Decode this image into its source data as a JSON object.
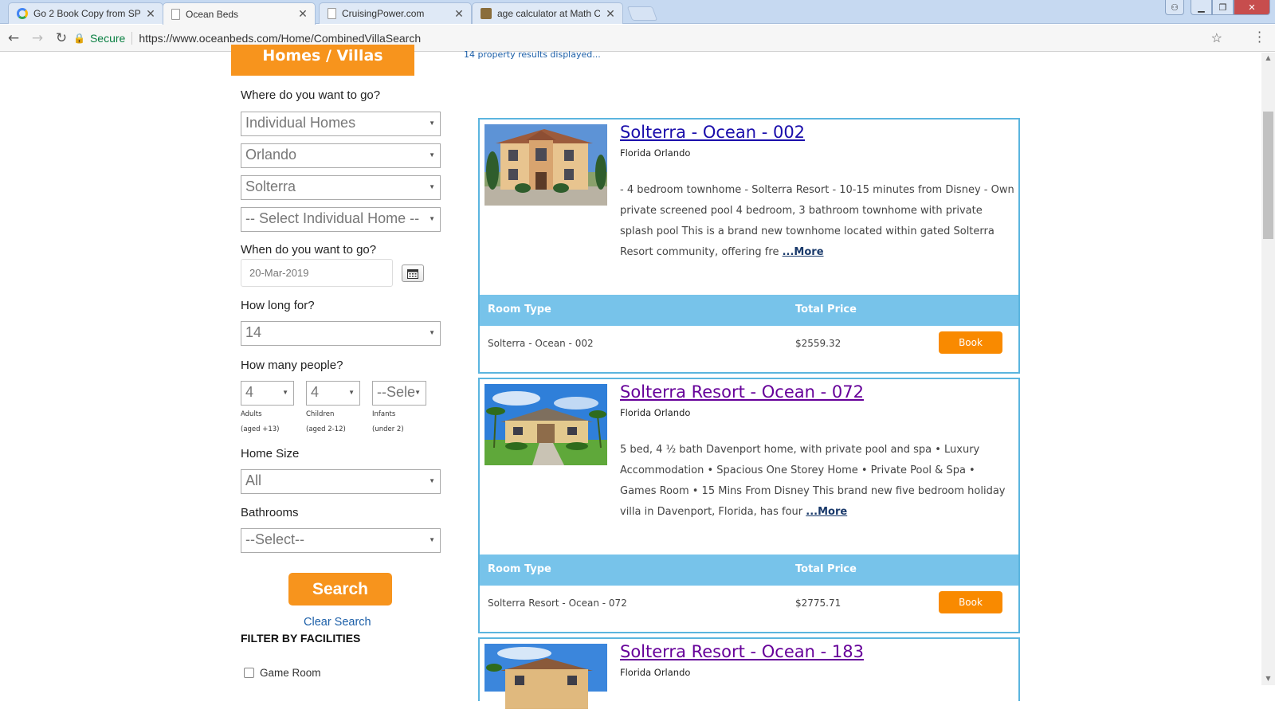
{
  "browser": {
    "tabs": [
      {
        "title": "Go 2 Book Copy from SP",
        "active": false
      },
      {
        "title": "Ocean Beds",
        "active": true
      },
      {
        "title": "CruisingPower.com",
        "active": false
      },
      {
        "title": "age calculator at Math C",
        "active": false
      }
    ],
    "secure_label": "Secure",
    "url": "https://www.oceanbeds.com/Home/CombinedVillaSearch"
  },
  "header": {
    "banner": "Homes / Villas",
    "results_count": "14 property results displayed..."
  },
  "search": {
    "where_label": "Where do you want to go?",
    "property_type": "Individual Homes",
    "city": "Orlando",
    "resort": "Solterra",
    "home": "-- Select Individual Home --",
    "when_label": "When do you want to go?",
    "date": "20-Mar-2019",
    "duration_label": "How long for?",
    "duration": "14",
    "people_label": "How many people?",
    "adults": "4",
    "children": "4",
    "infants": "--Sele",
    "adults_label": "Adults",
    "adults_note": "(aged +13)",
    "children_label": "Children",
    "children_note": "(aged 2-12)",
    "infants_label": "Infants",
    "infants_note": "(under 2)",
    "home_size_label": "Home Size",
    "home_size": "All",
    "bathrooms_label": "Bathrooms",
    "bathrooms": "--Select--",
    "search_button": "Search",
    "clear_search": "Clear Search",
    "filter_heading": "FILTER BY FACILITIES",
    "facilities": [
      "Game Room"
    ]
  },
  "results": [
    {
      "title": "Solterra - Ocean - 002",
      "location": "Florida Orlando",
      "description": "- 4 bedroom townhome - Solterra Resort - 10-15 minutes from Disney - Own private screened pool 4 bedroom, 3 bathroom townhome with private splash pool This is a brand new townhome located within gated Solterra Resort community, offering fre",
      "more": "...More",
      "room_type_header": "Room Type",
      "price_header": "Total Price",
      "room_type": "Solterra - Ocean - 002",
      "price": "$2559.32",
      "book": "Book"
    },
    {
      "title": "Solterra Resort - Ocean - 072",
      "location": "Florida Orlando",
      "description": "5 bed, 4 ½ bath Davenport home, with private pool and spa • Luxury Accommodation • Spacious One Storey Home • Private Pool & Spa • Games Room • 15 Mins From Disney This brand new five bedroom holiday villa in Davenport, Florida, has four",
      "more": "...More",
      "room_type_header": "Room Type",
      "price_header": "Total Price",
      "room_type": "Solterra Resort - Ocean - 072",
      "price": "$2775.71",
      "book": "Book"
    },
    {
      "title": "Solterra Resort - Ocean - 183",
      "location": "Florida Orlando"
    }
  ],
  "colors": {
    "accent": "#f7941d",
    "card_border": "#5bb5df",
    "table_header": "#77c3ea",
    "book_button": "#f98a00"
  }
}
